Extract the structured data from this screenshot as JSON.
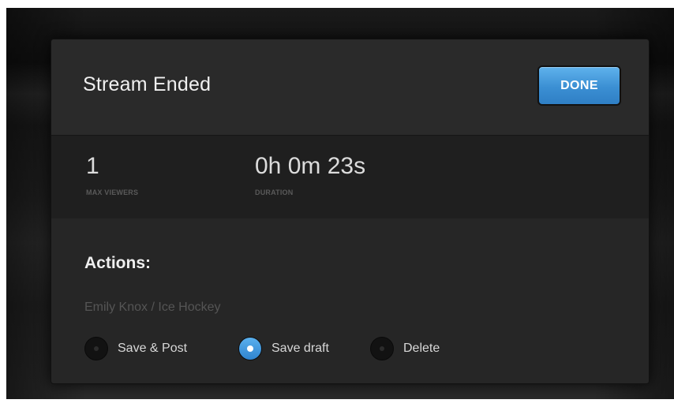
{
  "modal": {
    "title": "Stream Ended",
    "done_label": "DONE"
  },
  "stats": {
    "viewers": {
      "value": "1",
      "label": "MAX VIEWERS"
    },
    "duration": {
      "value": "0h 0m 23s",
      "label": "DURATION"
    }
  },
  "actions": {
    "title": "Actions:",
    "breadcrumb": {
      "user": "Emily Knox",
      "separator": " / ",
      "category": "Ice Hockey"
    },
    "options": [
      {
        "label": "Save & Post",
        "checked": false
      },
      {
        "label": "Save draft",
        "checked": true
      },
      {
        "label": "Delete",
        "checked": false
      }
    ]
  },
  "colors": {
    "accent": "#3b8fd3",
    "panel": "#282828",
    "stats_band": "#1f1f1f"
  },
  "icons": {
    "radio_unchecked": "radio-unchecked-icon",
    "radio_checked": "radio-checked-icon"
  }
}
